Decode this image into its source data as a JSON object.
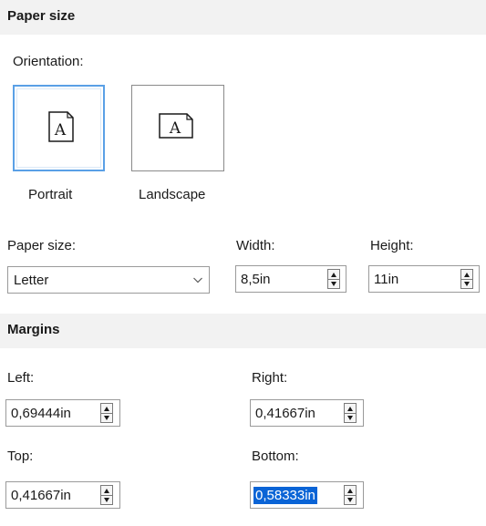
{
  "paper_section": {
    "title": "Paper size",
    "orientation_label": "Orientation:",
    "orientations": [
      {
        "label": "Portrait",
        "selected": true
      },
      {
        "label": "Landscape",
        "selected": false
      }
    ],
    "paper_size_label": "Paper size:",
    "paper_size_value": "Letter",
    "width_label": "Width:",
    "width_value": "8,5in",
    "height_label": "Height:",
    "height_value": "11in",
    "page_glyph": "A"
  },
  "margins_section": {
    "title": "Margins",
    "left_label": "Left:",
    "left_value": "0,69444in",
    "right_label": "Right:",
    "right_value": "0,41667in",
    "top_label": "Top:",
    "top_value": "0,41667in",
    "bottom_label": "Bottom:",
    "bottom_value": "0,58333in"
  },
  "colors": {
    "header_bg": "#f2f2f2",
    "selection_border": "#5aa0e6",
    "text_selection": "#0a64d6"
  }
}
